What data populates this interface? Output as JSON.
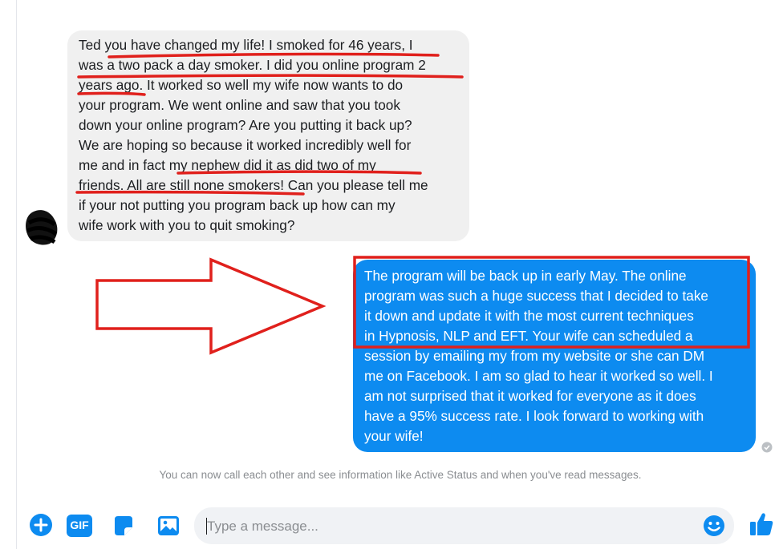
{
  "incoming_message": {
    "lines": [
      "Ted you have changed my life! I smoked for 46 years, I",
      "was a two pack a day smoker. I did you online program 2",
      "years ago. It worked so well my wife now wants to do",
      "your program. We went online and saw that you took",
      "down your online program? Are you putting it back up?",
      "We are hoping so because it worked incredibly well for",
      "me and in fact my nephew did it as did two of my",
      "friends. All are still none smokers! Can you please tell me",
      "if your not putting you program back up how can my",
      "wife work with you to quit smoking?"
    ]
  },
  "outgoing_message": {
    "lines": [
      "The program will be back up in early May. The online",
      "program was such a huge success that I decided to take",
      "it down and update it with the most current techniques",
      "in Hypnosis, NLP and EFT.  Your wife can scheduled a",
      "session by emailing my from my website or she can DM",
      "me on Facebook. I am so glad to hear it worked so well. I",
      "am not surprised that it worked for everyone as it does",
      "have a 95% success rate.  I look forward to working with",
      "your wife!"
    ]
  },
  "notice": "You can now call each other and see information like Active Status and when you've read messages.",
  "composer": {
    "placeholder": "Type a message...",
    "gif_label": "GIF"
  },
  "colors": {
    "accent": "#0d8bf0",
    "annotation_red": "#e0201c",
    "incoming_bubble": "#f0f0f0"
  },
  "icons": [
    "plus-circle-icon",
    "gif-icon",
    "sticker-icon",
    "image-icon",
    "emoji-icon",
    "thumbs-up-icon",
    "seen-check-icon"
  ]
}
